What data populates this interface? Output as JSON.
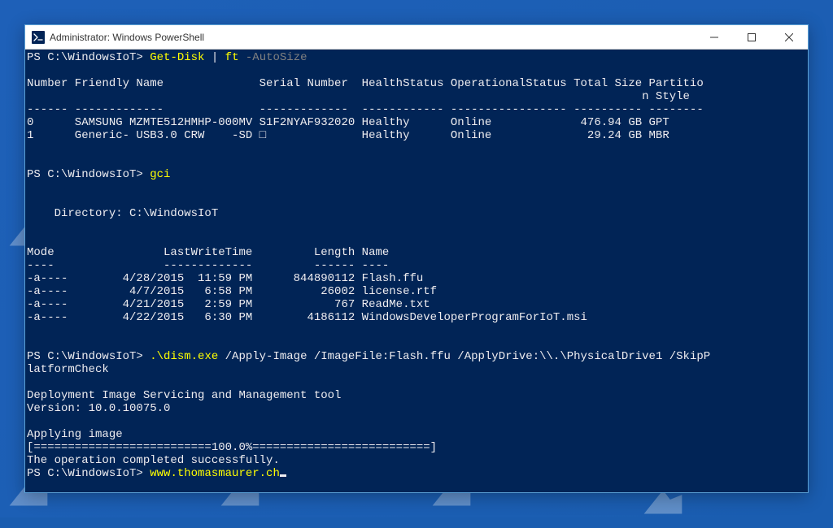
{
  "window": {
    "title": "Administrator: Windows PowerShell"
  },
  "terminal": {
    "prompt": "PS C:\\WindowsIoT> ",
    "cmd1": "Get-Disk",
    "cmd1_pipe": " | ",
    "cmd1b": "ft",
    "cmd1_arg": " -AutoSize",
    "header1": "Number Friendly Name              Serial Number  HealthStatus OperationalStatus Total Size Partitio",
    "header1b": "                                                                                          n Style",
    "divider1": "------ -------------              -------------  ------------ ----------------- ---------- --------",
    "row1": "0      SAMSUNG MZMTE512HMHP-000MV S1F2NYAF932020 Healthy      Online             476.94 GB GPT",
    "row2": "1      Generic- USB3.0 CRW    -SD □              Healthy      Online              29.24 GB MBR",
    "cmd2": "gci",
    "dir_header": "    Directory: C:\\WindowsIoT",
    "col_header": "Mode                LastWriteTime         Length Name",
    "col_div": "----                -------------         ------ ----",
    "file1": "-a----        4/28/2015  11:59 PM      844890112 Flash.ffu",
    "file2": "-a----         4/7/2015   6:58 PM          26002 license.rtf",
    "file3": "-a----        4/21/2015   2:59 PM            767 ReadMe.txt",
    "file4": "-a----        4/22/2015   6:30 PM        4186112 WindowsDeveloperProgramForIoT.msi",
    "cmd3": ".\\dism.exe",
    "cmd3_args": " /Apply-Image /ImageFile:Flash.ffu /ApplyDrive:\\\\.\\PhysicalDrive1 /SkipP",
    "cmd3_args2": "latformCheck",
    "dism1": "Deployment Image Servicing and Management tool",
    "dism2": "Version: 10.0.10075.0",
    "dism3": "Applying image",
    "dism4": "[==========================100.0%==========================]",
    "dism5": "The operation completed successfully.",
    "cmd4": "www.thomasmaurer.ch"
  },
  "chart_data": {
    "type": "table",
    "tables": [
      {
        "title": "Get-Disk output",
        "columns": [
          "Number",
          "Friendly Name",
          "Serial Number",
          "HealthStatus",
          "OperationalStatus",
          "Total Size",
          "Partition Style"
        ],
        "rows": [
          [
            0,
            "SAMSUNG MZMTE512HMHP-000MV",
            "S1F2NYAF932020",
            "Healthy",
            "Online",
            "476.94 GB",
            "GPT"
          ],
          [
            1,
            "Generic- USB3.0 CRW    -SD",
            "",
            "Healthy",
            "Online",
            "29.24 GB",
            "MBR"
          ]
        ]
      },
      {
        "title": "Directory: C:\\WindowsIoT",
        "columns": [
          "Mode",
          "LastWriteTime",
          "Length",
          "Name"
        ],
        "rows": [
          [
            "-a----",
            "4/28/2015 11:59 PM",
            844890112,
            "Flash.ffu"
          ],
          [
            "-a----",
            "4/7/2015 6:58 PM",
            26002,
            "license.rtf"
          ],
          [
            "-a----",
            "4/21/2015 2:59 PM",
            767,
            "ReadMe.txt"
          ],
          [
            "-a----",
            "4/22/2015 6:30 PM",
            4186112,
            "WindowsDeveloperProgramForIoT.msi"
          ]
        ]
      }
    ]
  }
}
